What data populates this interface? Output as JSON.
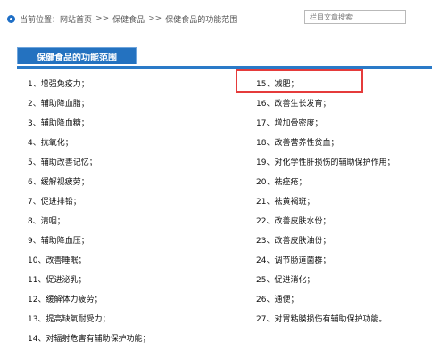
{
  "breadcrumb": {
    "prefix": "当前位置：",
    "home": "网站首页",
    "sep1": ">>",
    "category": "保健食品",
    "sep2": ">>",
    "current": "保健食品的功能范围"
  },
  "search": {
    "placeholder": "栏目文章搜索"
  },
  "section": {
    "title": "保健食品的功能范围"
  },
  "left_items": [
    "1、增强免疫力；",
    "2、辅助降血脂；",
    "3、辅助降血糖；",
    "4、抗氧化；",
    "5、辅助改善记忆；",
    "6、缓解视疲劳；",
    "7、促进排铅；",
    "8、清咽；",
    "9、辅助降血压；",
    "10、改善睡眠；",
    "11、促进泌乳；",
    "12、缓解体力疲劳；",
    "13、提高缺氧耐受力；",
    "14、对辐射危害有辅助保护功能；"
  ],
  "right_items": [
    "15、减肥；",
    "16、改善生长发育；",
    "17、增加骨密度；",
    "18、改善营养性贫血；",
    "19、对化学性肝损伤的辅助保护作用；",
    "20、祛痤疮；",
    "21、祛黄褐斑；",
    "22、改善皮肤水份；",
    "23、改善皮肤油份；",
    "24、调节肠道菌群；",
    "25、促进消化；",
    "26、通便；",
    "27、对胃粘膜损伤有辅助保护功能。"
  ],
  "colors": {
    "accent": "#2472c0",
    "highlight": "#e53b3b"
  }
}
